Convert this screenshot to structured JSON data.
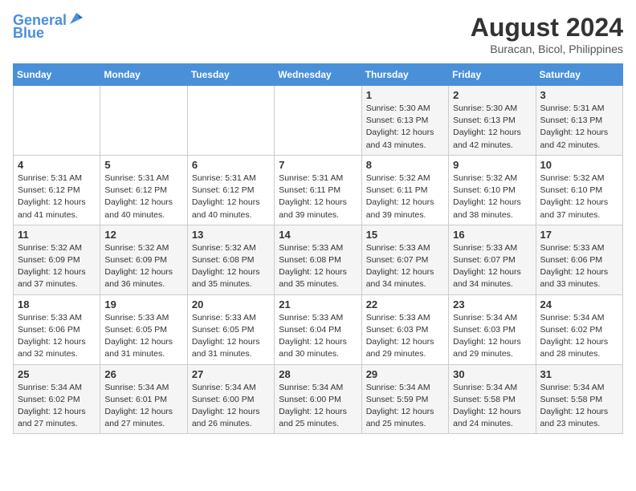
{
  "logo": {
    "line1": "General",
    "line2": "Blue"
  },
  "title": "August 2024",
  "subtitle": "Buracan, Bicol, Philippines",
  "headers": [
    "Sunday",
    "Monday",
    "Tuesday",
    "Wednesday",
    "Thursday",
    "Friday",
    "Saturday"
  ],
  "weeks": [
    [
      {
        "day": "",
        "info": ""
      },
      {
        "day": "",
        "info": ""
      },
      {
        "day": "",
        "info": ""
      },
      {
        "day": "",
        "info": ""
      },
      {
        "day": "1",
        "info": "Sunrise: 5:30 AM\nSunset: 6:13 PM\nDaylight: 12 hours\nand 43 minutes."
      },
      {
        "day": "2",
        "info": "Sunrise: 5:30 AM\nSunset: 6:13 PM\nDaylight: 12 hours\nand 42 minutes."
      },
      {
        "day": "3",
        "info": "Sunrise: 5:31 AM\nSunset: 6:13 PM\nDaylight: 12 hours\nand 42 minutes."
      }
    ],
    [
      {
        "day": "4",
        "info": "Sunrise: 5:31 AM\nSunset: 6:12 PM\nDaylight: 12 hours\nand 41 minutes."
      },
      {
        "day": "5",
        "info": "Sunrise: 5:31 AM\nSunset: 6:12 PM\nDaylight: 12 hours\nand 40 minutes."
      },
      {
        "day": "6",
        "info": "Sunrise: 5:31 AM\nSunset: 6:12 PM\nDaylight: 12 hours\nand 40 minutes."
      },
      {
        "day": "7",
        "info": "Sunrise: 5:31 AM\nSunset: 6:11 PM\nDaylight: 12 hours\nand 39 minutes."
      },
      {
        "day": "8",
        "info": "Sunrise: 5:32 AM\nSunset: 6:11 PM\nDaylight: 12 hours\nand 39 minutes."
      },
      {
        "day": "9",
        "info": "Sunrise: 5:32 AM\nSunset: 6:10 PM\nDaylight: 12 hours\nand 38 minutes."
      },
      {
        "day": "10",
        "info": "Sunrise: 5:32 AM\nSunset: 6:10 PM\nDaylight: 12 hours\nand 37 minutes."
      }
    ],
    [
      {
        "day": "11",
        "info": "Sunrise: 5:32 AM\nSunset: 6:09 PM\nDaylight: 12 hours\nand 37 minutes."
      },
      {
        "day": "12",
        "info": "Sunrise: 5:32 AM\nSunset: 6:09 PM\nDaylight: 12 hours\nand 36 minutes."
      },
      {
        "day": "13",
        "info": "Sunrise: 5:32 AM\nSunset: 6:08 PM\nDaylight: 12 hours\nand 35 minutes."
      },
      {
        "day": "14",
        "info": "Sunrise: 5:33 AM\nSunset: 6:08 PM\nDaylight: 12 hours\nand 35 minutes."
      },
      {
        "day": "15",
        "info": "Sunrise: 5:33 AM\nSunset: 6:07 PM\nDaylight: 12 hours\nand 34 minutes."
      },
      {
        "day": "16",
        "info": "Sunrise: 5:33 AM\nSunset: 6:07 PM\nDaylight: 12 hours\nand 34 minutes."
      },
      {
        "day": "17",
        "info": "Sunrise: 5:33 AM\nSunset: 6:06 PM\nDaylight: 12 hours\nand 33 minutes."
      }
    ],
    [
      {
        "day": "18",
        "info": "Sunrise: 5:33 AM\nSunset: 6:06 PM\nDaylight: 12 hours\nand 32 minutes."
      },
      {
        "day": "19",
        "info": "Sunrise: 5:33 AM\nSunset: 6:05 PM\nDaylight: 12 hours\nand 31 minutes."
      },
      {
        "day": "20",
        "info": "Sunrise: 5:33 AM\nSunset: 6:05 PM\nDaylight: 12 hours\nand 31 minutes."
      },
      {
        "day": "21",
        "info": "Sunrise: 5:33 AM\nSunset: 6:04 PM\nDaylight: 12 hours\nand 30 minutes."
      },
      {
        "day": "22",
        "info": "Sunrise: 5:33 AM\nSunset: 6:03 PM\nDaylight: 12 hours\nand 29 minutes."
      },
      {
        "day": "23",
        "info": "Sunrise: 5:34 AM\nSunset: 6:03 PM\nDaylight: 12 hours\nand 29 minutes."
      },
      {
        "day": "24",
        "info": "Sunrise: 5:34 AM\nSunset: 6:02 PM\nDaylight: 12 hours\nand 28 minutes."
      }
    ],
    [
      {
        "day": "25",
        "info": "Sunrise: 5:34 AM\nSunset: 6:02 PM\nDaylight: 12 hours\nand 27 minutes."
      },
      {
        "day": "26",
        "info": "Sunrise: 5:34 AM\nSunset: 6:01 PM\nDaylight: 12 hours\nand 27 minutes."
      },
      {
        "day": "27",
        "info": "Sunrise: 5:34 AM\nSunset: 6:00 PM\nDaylight: 12 hours\nand 26 minutes."
      },
      {
        "day": "28",
        "info": "Sunrise: 5:34 AM\nSunset: 6:00 PM\nDaylight: 12 hours\nand 25 minutes."
      },
      {
        "day": "29",
        "info": "Sunrise: 5:34 AM\nSunset: 5:59 PM\nDaylight: 12 hours\nand 25 minutes."
      },
      {
        "day": "30",
        "info": "Sunrise: 5:34 AM\nSunset: 5:58 PM\nDaylight: 12 hours\nand 24 minutes."
      },
      {
        "day": "31",
        "info": "Sunrise: 5:34 AM\nSunset: 5:58 PM\nDaylight: 12 hours\nand 23 minutes."
      }
    ]
  ]
}
